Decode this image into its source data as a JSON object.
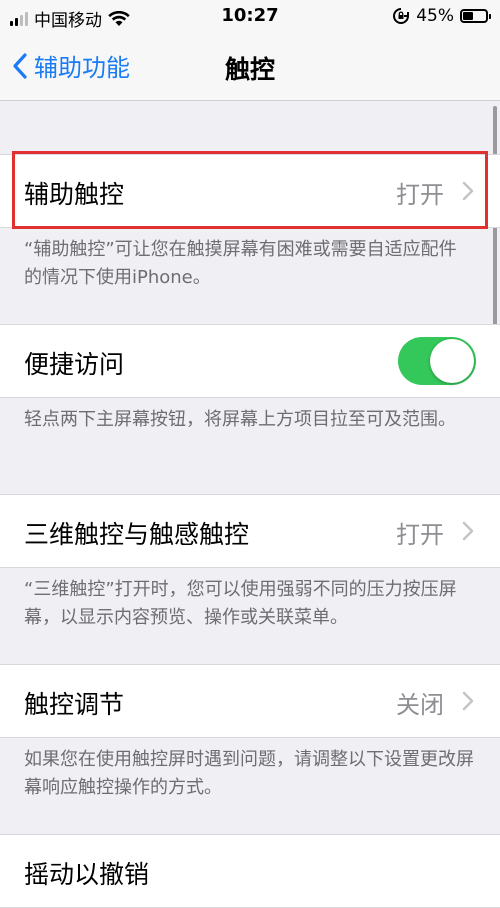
{
  "status_bar": {
    "carrier": "中国移动",
    "time": "10:27",
    "battery_pct": "45%",
    "battery_level": 0.45
  },
  "nav": {
    "back_label": "辅助功能",
    "title": "触控"
  },
  "sections": [
    {
      "label": "辅助触控",
      "value": "打开",
      "note": "“辅助触控”可让您在触摸屏幕有困难或需要自适应配件的情况下使用iPhone。"
    },
    {
      "label": "便捷访问",
      "toggle_on": true,
      "note": "轻点两下主屏幕按钮，将屏幕上方项目拉至可及范围。"
    },
    {
      "label": "三维触控与触感触控",
      "value": "打开",
      "note": "“三维触控”打开时，您可以使用强弱不同的压力按压屏幕，以显示内容预览、操作或关联菜单。"
    },
    {
      "label": "触控调节",
      "value": "关闭",
      "note": "如果您在使用触控屏时遇到问题，请调整以下设置更改屏幕响应触控操作的方式。"
    },
    {
      "label": "摇动以撤销"
    }
  ],
  "colors": {
    "accent": "#1a7cf5",
    "toggle_on": "#34c759",
    "highlight": "#e03030"
  }
}
